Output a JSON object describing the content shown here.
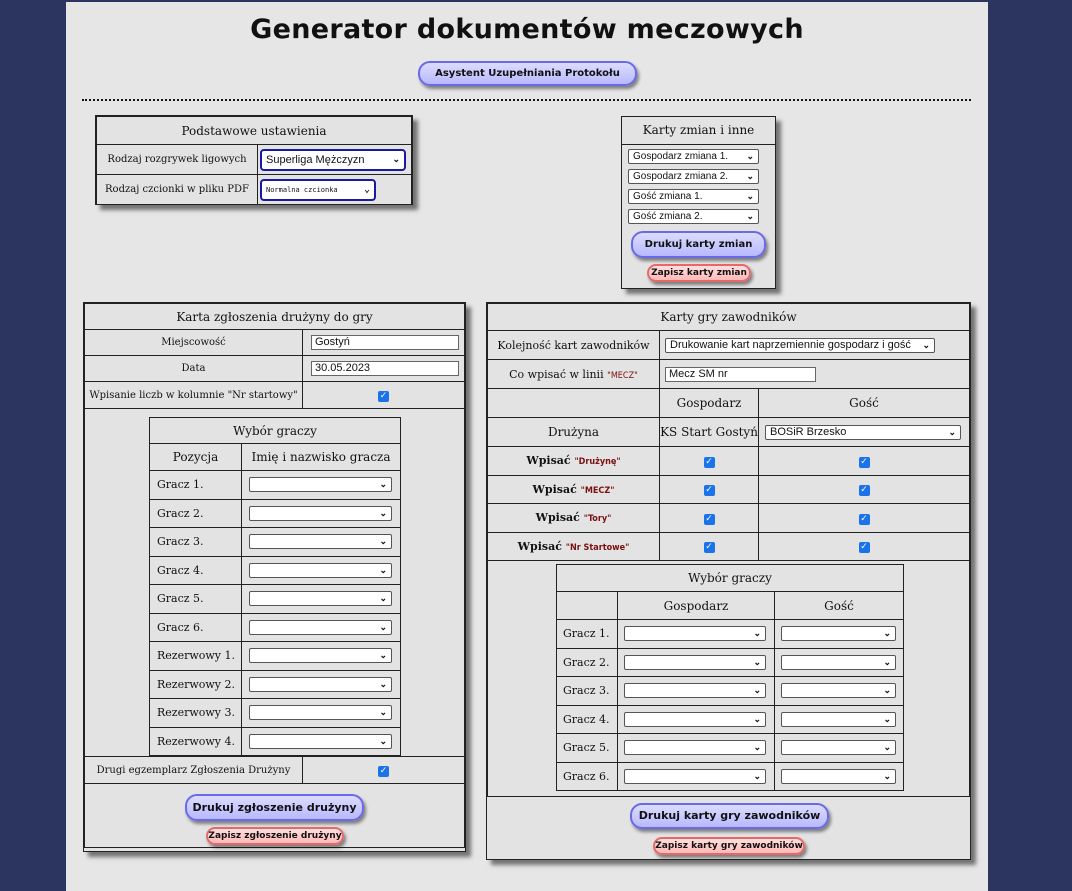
{
  "title": "Generator dokumentów meczowych",
  "assistant_button": "Asystent Uzupełniania Protokołu",
  "basic": {
    "header": "Podstawowe ustawienia",
    "league_label": "Rodzaj rozgrywek ligowych",
    "league_value": "Superliga Mężczyzn",
    "font_label": "Rodzaj czcionki w pliku PDF",
    "font_value": "Normalna czcionka"
  },
  "subs": {
    "header": "Karty zmian i inne",
    "selects": [
      "Gospodarz zmiana 1.",
      "Gospodarz zmiana 2.",
      "Gość zmiana 1.",
      "Gość zmiana 2."
    ],
    "print_button": "Drukuj karty zmian",
    "save_button": "Zapisz karty zmian"
  },
  "team_card": {
    "header": "Karta zgłoszenia drużyny do gry",
    "place_label": "Miejscowość",
    "place_value": "Gostyń",
    "date_label": "Data",
    "date_value": "30.05.2023",
    "numbers_label": "Wpisanie liczb w kolumnie \"Nr startowy\"",
    "numbers_checked": true,
    "players_header": "Wybór graczy",
    "col_position": "Pozycja",
    "col_name": "Imię i nazwisko gracza",
    "players": [
      "Gracz 1.",
      "Gracz 2.",
      "Gracz 3.",
      "Gracz 4.",
      "Gracz 5.",
      "Gracz 6.",
      "Rezerwowy 1.",
      "Rezerwowy 2.",
      "Rezerwowy 3.",
      "Rezerwowy 4."
    ],
    "second_copy_label": "Drugi egzemplarz Zgłoszenia Drużyny",
    "second_copy_checked": true,
    "print_button": "Drukuj zgłoszenie drużyny",
    "save_button": "Zapisz zgłoszenie drużyny"
  },
  "game_cards": {
    "header": "Karty gry zawodników",
    "order_label": "Kolejność kart zawodników",
    "order_value": "Drukowanie kart naprzemiennie gospodarz i gość",
    "mecz_label": "Co wpisać w linii",
    "mecz_quote": "\"MECZ\"",
    "mecz_value": "Mecz SM nr",
    "col_home": "Gospodarz",
    "col_away": "Gość",
    "team_label": "Drużyna",
    "home_team": "KS Start Gostyń",
    "away_team": "BOSiR Brzesko",
    "wpisac": "Wpisać",
    "write_rows": [
      {
        "quote": "\"Drużynę\""
      },
      {
        "quote": "\"MECZ\""
      },
      {
        "quote": "\"Tory\""
      },
      {
        "quote": "\"Nr Startowe\""
      }
    ],
    "players_header": "Wybór graczy",
    "players": [
      "Gracz 1.",
      "Gracz 2.",
      "Gracz 3.",
      "Gracz 4.",
      "Gracz 5.",
      "Gracz 6."
    ],
    "print_button": "Drukuj karty gry zawodników",
    "save_button": "Zapisz karty gry zawodników"
  }
}
